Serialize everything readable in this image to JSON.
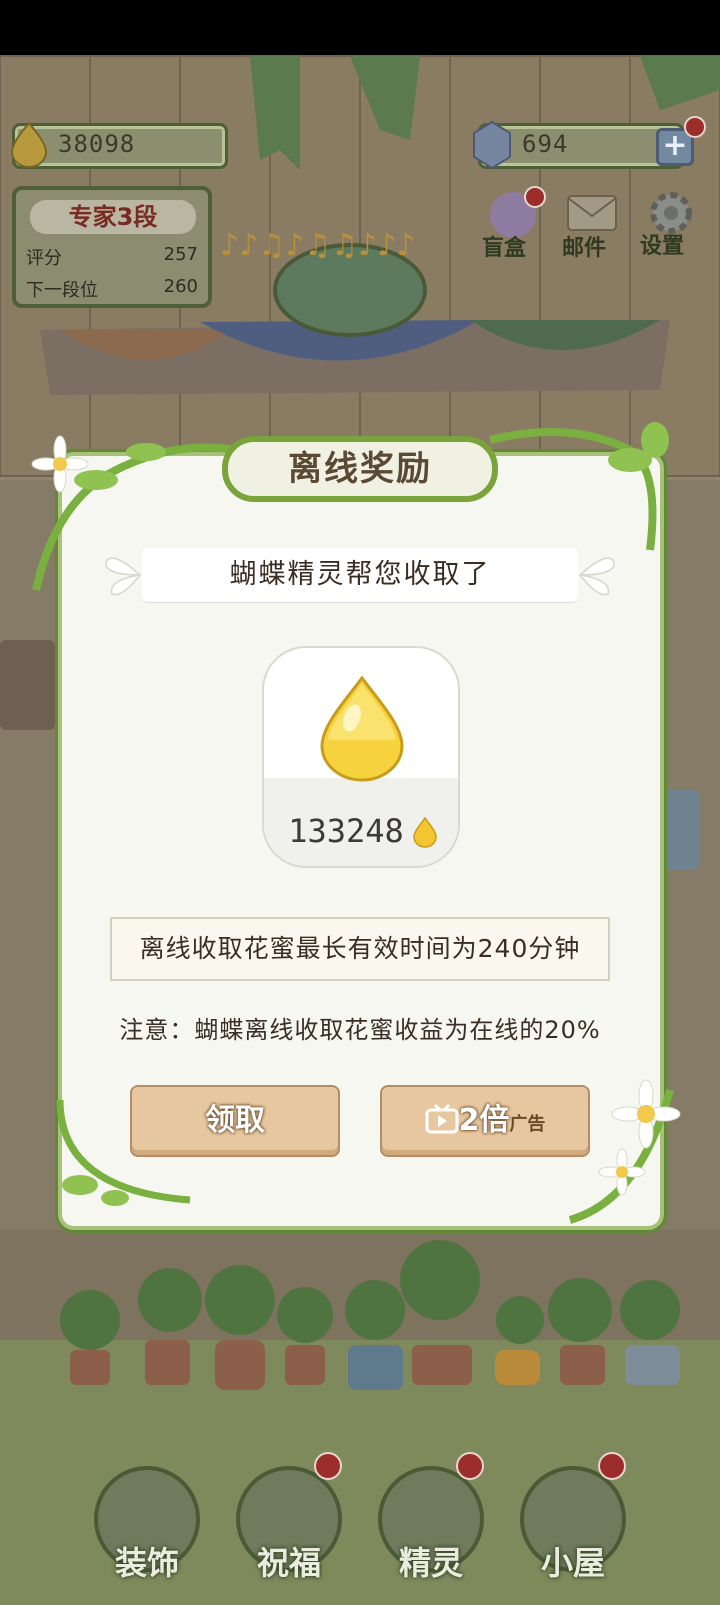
{
  "hud": {
    "nectar_amount": "38098",
    "gem_amount": "694",
    "add_icon": "plus-icon"
  },
  "rank": {
    "title": "专家3段",
    "score_label": "评分",
    "score_value": "257",
    "next_label": "下一段位",
    "next_value": "260"
  },
  "top_menu": [
    {
      "label": "盲盒",
      "icon": "blind-box-icon"
    },
    {
      "label": "邮件",
      "icon": "mail-icon"
    },
    {
      "label": "设置",
      "icon": "gear-icon"
    }
  ],
  "modal": {
    "title": "离线奖励",
    "subtitle": "蝴蝶精灵帮您收取了",
    "reward_amount": "133248",
    "reward_icon": "nectar-drop-icon",
    "info": "离线收取花蜜最长有效时间为240分钟",
    "note": "注意：蝴蝶离线收取花蜜收益为在线的20%",
    "claim_label": "领取",
    "double_label": "2倍",
    "ad_tag": "广告",
    "video_icon": "tv-play-icon"
  },
  "bottom_nav": [
    {
      "label": "装饰",
      "icon": "plant-pot-icon"
    },
    {
      "label": "祝福",
      "icon": "butterfly-icon"
    },
    {
      "label": "精灵",
      "icon": "fairy-icon"
    },
    {
      "label": "小屋",
      "icon": "house-icon"
    }
  ],
  "colors": {
    "accent_green": "#7aa33c",
    "button_tan": "#e7c7a0",
    "badge_red": "#9b2e2a",
    "nectar_gold": "#f3c52e"
  }
}
